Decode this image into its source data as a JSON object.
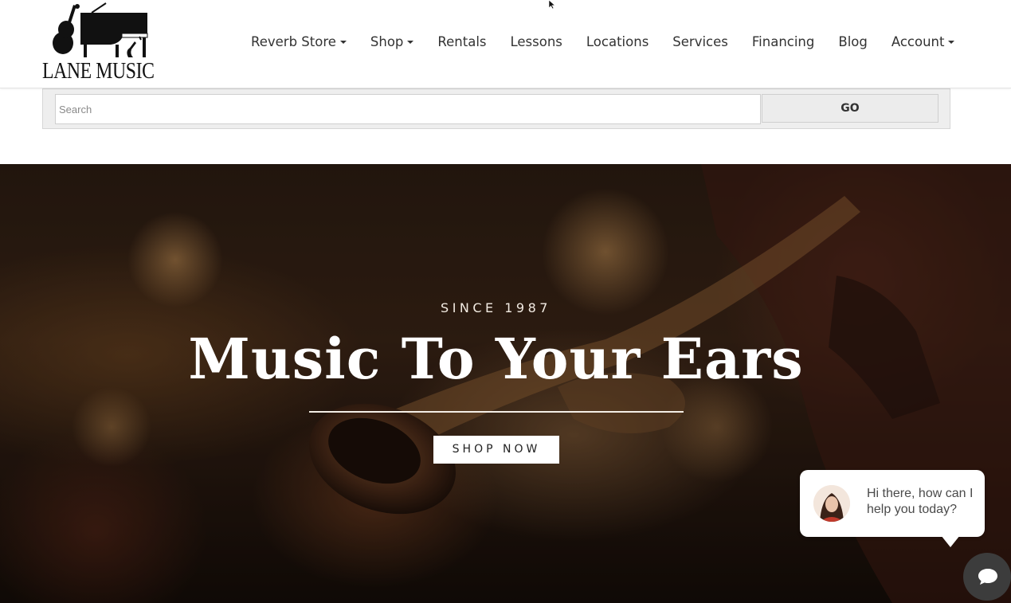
{
  "brand": {
    "logo_text": "LANE MUSIC",
    "logo_icon": "instruments-logo-icon"
  },
  "nav": {
    "items": [
      {
        "label": "Reverb Store",
        "has_dropdown": true
      },
      {
        "label": "Shop",
        "has_dropdown": true
      },
      {
        "label": "Rentals",
        "has_dropdown": false
      },
      {
        "label": "Lessons",
        "has_dropdown": false
      },
      {
        "label": "Locations",
        "has_dropdown": false
      },
      {
        "label": "Services",
        "has_dropdown": false
      },
      {
        "label": "Financing",
        "has_dropdown": false
      },
      {
        "label": "Blog",
        "has_dropdown": false
      },
      {
        "label": "Account",
        "has_dropdown": true
      }
    ]
  },
  "search": {
    "placeholder": "Search",
    "value": "",
    "button_label": "GO"
  },
  "hero": {
    "eyebrow": "SINCE 1987",
    "title": "Music To Your Ears",
    "cta_label": "SHOP NOW",
    "background": "trumpet-player-photo"
  },
  "chat": {
    "message": "Hi there, how can I help you today?",
    "avatar": "agent-avatar",
    "launcher_icon": "chat-icon"
  },
  "colors": {
    "nav_text": "#333333",
    "hero_text": "#ffffff",
    "chat_launcher": "#3c3c3c"
  }
}
